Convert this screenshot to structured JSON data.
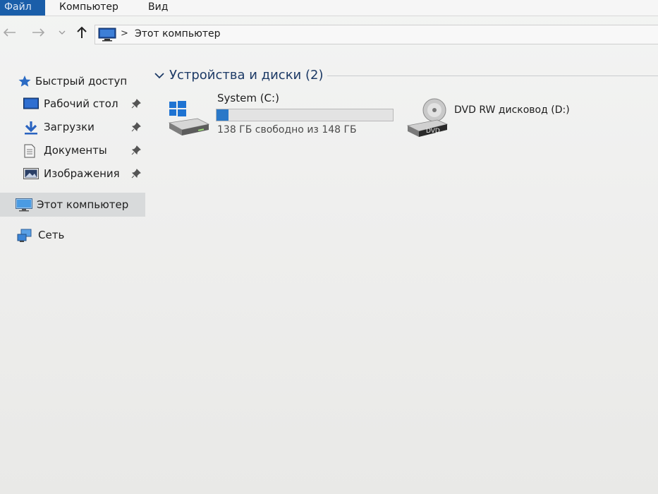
{
  "ribbon": {
    "tabs": [
      {
        "label": "Файл"
      },
      {
        "label": "Компьютер"
      },
      {
        "label": "Вид"
      }
    ]
  },
  "address": {
    "separator": ">",
    "path": "Этот компьютер"
  },
  "sidebar": {
    "quick_access": {
      "label": "Быстрый доступ"
    },
    "items": [
      {
        "label": "Рабочий стол",
        "pinned": true
      },
      {
        "label": "Загрузки",
        "pinned": true
      },
      {
        "label": "Документы",
        "pinned": true
      },
      {
        "label": "Изображения",
        "pinned": true
      }
    ],
    "this_pc": {
      "label": "Этот компьютер",
      "selected": true
    },
    "network": {
      "label": "Сеть"
    }
  },
  "main": {
    "group_title": "Устройства и диски (2)",
    "drives": [
      {
        "name": "System (C:)",
        "free_text": "138 ГБ свободно из 148 ГБ",
        "used_fraction": 0.068
      },
      {
        "name": "DVD RW дисковод (D:)",
        "icon_label": "DVD"
      }
    ]
  },
  "colors": {
    "accent": "#1a5ea9",
    "bar_fill": "#2a78c8"
  }
}
